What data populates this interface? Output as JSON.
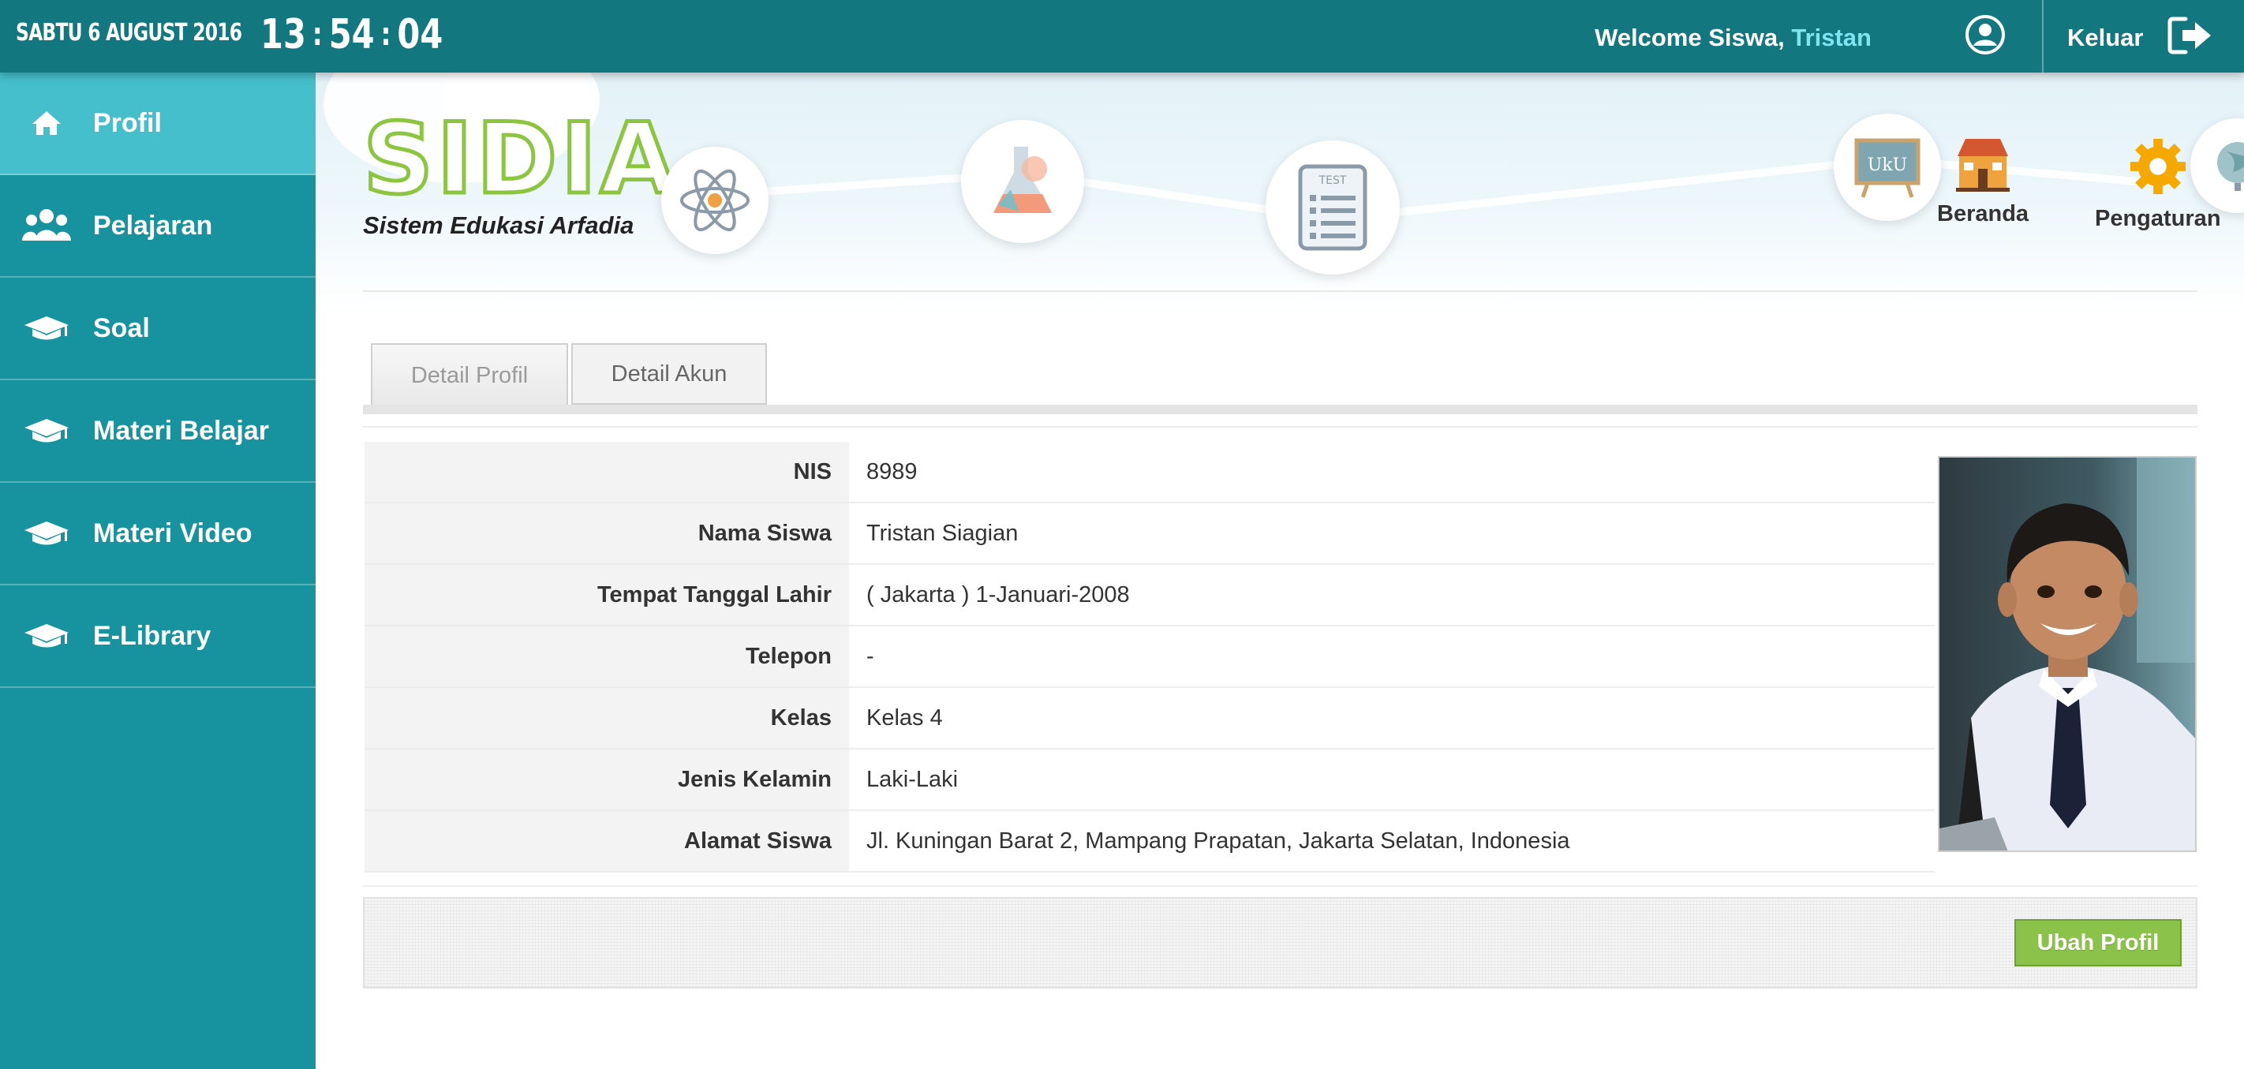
{
  "topbar": {
    "date": "SABTU 6 AUGUST 2016",
    "clock": {
      "hours": "13",
      "minutes": "54",
      "seconds": "04",
      "separator": ":"
    },
    "welcome_prefix": "Welcome Siswa,",
    "user_name": "Tristan",
    "user_icon": "user-circle-icon",
    "logout_label": "Keluar",
    "logout_icon": "sign-out-icon"
  },
  "sidebar": {
    "items": [
      {
        "label": "Profil",
        "icon": "home-icon",
        "active": true
      },
      {
        "label": "Pelajaran",
        "icon": "users-icon",
        "active": false
      },
      {
        "label": "Soal",
        "icon": "graduation-cap-icon",
        "active": false
      },
      {
        "label": "Materi Belajar",
        "icon": "graduation-cap-icon",
        "active": false
      },
      {
        "label": "Materi Video",
        "icon": "graduation-cap-icon",
        "active": false
      },
      {
        "label": "E-Library",
        "icon": "graduation-cap-icon",
        "active": false
      }
    ]
  },
  "header": {
    "logo_text": "SIDIA",
    "logo_subtitle": "Sistem Edukasi Arfadia",
    "nav": [
      {
        "label": "Beranda",
        "icon": "school-house-icon"
      },
      {
        "label": "Pengaturan",
        "icon": "gear-icon"
      }
    ]
  },
  "tabs": [
    {
      "label": "Detail Profil",
      "active": true
    },
    {
      "label": "Detail Akun",
      "active": false
    }
  ],
  "profile": {
    "rows": [
      {
        "label": "NIS",
        "value": "8989"
      },
      {
        "label": "Nama Siswa",
        "value": "Tristan Siagian"
      },
      {
        "label": "Tempat Tanggal Lahir",
        "value": "( Jakarta ) 1-Januari-2008"
      },
      {
        "label": "Telepon",
        "value": "-"
      },
      {
        "label": "Kelas",
        "value": "Kelas 4"
      },
      {
        "label": "Jenis Kelamin",
        "value": "Laki-Laki"
      },
      {
        "label": "Alamat Siswa",
        "value": "Jl. Kuningan Barat 2, Mampang Prapatan, Jakarta Selatan, Indonesia"
      }
    ]
  },
  "footer": {
    "edit_button": "Ubah Profil"
  },
  "colors": {
    "topbar": "#137780",
    "sidebar": "#16939f",
    "sidebar_active": "#45bfcb",
    "accent_name": "#7fe4ee",
    "logo_green": "#8cc63f",
    "button_green": "#8bc34a"
  }
}
